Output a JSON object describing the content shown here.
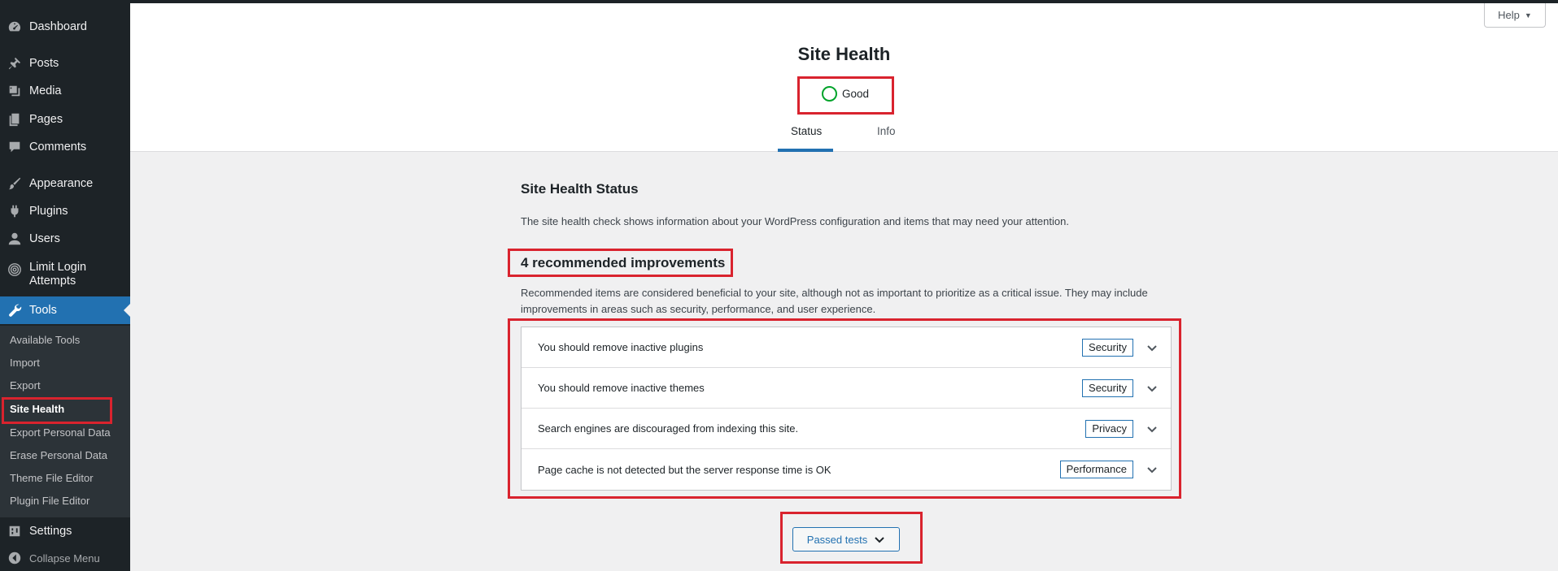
{
  "sidebar": {
    "items": [
      {
        "label": "Dashboard",
        "icon": "dashboard-icon"
      },
      {
        "label": "Posts",
        "icon": "pushpin-icon"
      },
      {
        "label": "Media",
        "icon": "media-icon"
      },
      {
        "label": "Pages",
        "icon": "pages-icon"
      },
      {
        "label": "Comments",
        "icon": "comment-icon"
      },
      {
        "label": "Appearance",
        "icon": "paintbrush-icon"
      },
      {
        "label": "Plugins",
        "icon": "plugin-icon"
      },
      {
        "label": "Users",
        "icon": "user-icon"
      },
      {
        "label": "Limit Login Attempts",
        "icon": "fingerprint-icon"
      },
      {
        "label": "Tools",
        "icon": "wrench-icon"
      },
      {
        "label": "Settings",
        "icon": "settings-icon"
      },
      {
        "label": "Collapse Menu",
        "icon": "collapse-icon"
      }
    ],
    "tools_submenu": [
      "Available Tools",
      "Import",
      "Export",
      "Site Health",
      "Export Personal Data",
      "Erase Personal Data",
      "Theme File Editor",
      "Plugin File Editor"
    ]
  },
  "header": {
    "title": "Site Health",
    "score_label": "Good",
    "tabs": [
      "Status",
      "Info"
    ],
    "help_label": "Help"
  },
  "main": {
    "section_title": "Site Health Status",
    "description": "The site health check shows information about your WordPress configuration and items that may need your attention.",
    "improvements_title": "4 recommended improvements",
    "improvements_description": "Recommended items are considered beneficial to your site, although not as important to prioritize as a critical issue. They may include improvements in areas such as security, performance, and user experience.",
    "issues": [
      {
        "title": "You should remove inactive plugins",
        "badge": "Security"
      },
      {
        "title": "You should remove inactive themes",
        "badge": "Security"
      },
      {
        "title": "Search engines are discouraged from indexing this site.",
        "badge": "Privacy"
      },
      {
        "title": "Page cache is not detected but the server response time is OK",
        "badge": "Performance"
      }
    ],
    "passed_tests_label": "Passed tests"
  },
  "colors": {
    "sidebar_bg": "#1d2327",
    "accent": "#2271b1",
    "good": "#00a32a",
    "highlight": "#d9232e"
  }
}
